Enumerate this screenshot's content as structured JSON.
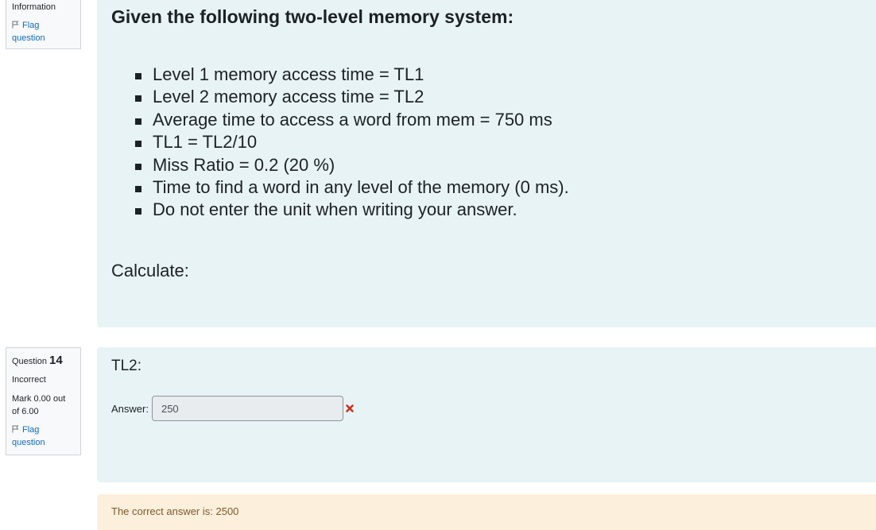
{
  "prev_question_info": {
    "info_label": "Information",
    "flag_label_line1": "Flag",
    "flag_label_line2": "question"
  },
  "question_text": {
    "heading": "Given the following two-level memory system:",
    "bullets": [
      "Level 1 memory access time = TL1",
      "Level 2 memory access time = TL2",
      "Average time to access a word from mem = 750 ms",
      "TL1 = TL2/10",
      "Miss Ratio = 0.2 (20 %)",
      "Time to find a word in any level of the memory (0 ms).",
      "Do not enter the unit when writing your answer."
    ],
    "calculate": "Calculate:"
  },
  "question_14": {
    "question_label": "Question",
    "number": "14",
    "status": "Incorrect",
    "mark_line1": "Mark 0.00 out",
    "mark_line2": "of 6.00",
    "flag_label_line1": "Flag",
    "flag_label_line2": "question",
    "prompt": "TL2:",
    "answer_label": "Answer:",
    "answer_value": "250",
    "result_icon": "incorrect-cross-icon",
    "correct_answer_text": "The correct answer is: 2500"
  },
  "colors": {
    "formulation_bg": "#e7f3f5",
    "feedback_bg": "#fcefdc",
    "link": "#0f6cbf",
    "incorrect": "#ca3120"
  }
}
